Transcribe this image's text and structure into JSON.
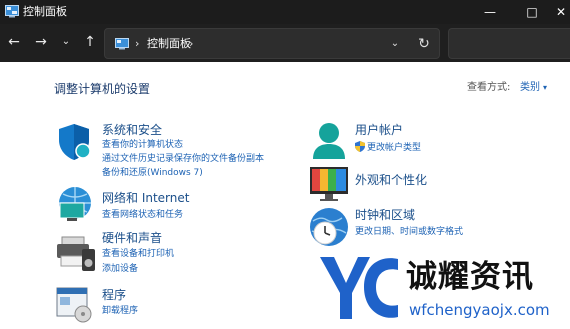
{
  "window": {
    "title": "控制面板",
    "minimize_glyph": "—",
    "maximize_glyph": "□",
    "close_glyph": "✕"
  },
  "nav": {
    "back_glyph": "←",
    "forward_glyph": "→",
    "recent_glyph": "⌄",
    "up_glyph": "↑",
    "breadcrumb_sep": "›",
    "breadcrumb": "控制面板",
    "dropdown_glyph": "⌄",
    "refresh_glyph": "↻",
    "search_placeholder": ""
  },
  "main": {
    "title": "调整计算机的设置",
    "view_by_label": "查看方式:",
    "view_by_value": "类别",
    "view_caret": "▾"
  },
  "categories": [
    {
      "icon": "system-security-shield-icon",
      "title": "系统和安全",
      "links": [
        "查看你的计算机状态",
        "通过文件历史记录保存你的文件备份副本",
        "备份和还原(Windows 7)"
      ]
    },
    {
      "icon": "network-internet-icon",
      "title": "网络和 Internet",
      "links": [
        "查看网络状态和任务"
      ]
    },
    {
      "icon": "hardware-sound-printer-icon",
      "title": "硬件和声音",
      "links": [
        "查看设备和打印机",
        "添加设备"
      ]
    },
    {
      "icon": "programs-icon",
      "title": "程序",
      "links": [
        "卸载程序"
      ]
    },
    {
      "icon": "user-accounts-icon",
      "title": "用户帐户",
      "links": [
        "更改帐户类型"
      ]
    },
    {
      "icon": "appearance-personalization-icon",
      "title": "外观和个性化",
      "links": []
    },
    {
      "icon": "clock-region-icon",
      "title": "时钟和区域",
      "links": [
        "更改日期、时间或数字格式"
      ]
    }
  ],
  "watermark": {
    "name": "诚耀资讯",
    "url": "wfchengyaojx.com"
  },
  "colors": {
    "titlebar": "#1c1c1c",
    "navbar": "#1f1f1f",
    "category_title": "#1b4f8a",
    "link": "#1e63b4",
    "watermark_blue": "#1f62c9"
  }
}
